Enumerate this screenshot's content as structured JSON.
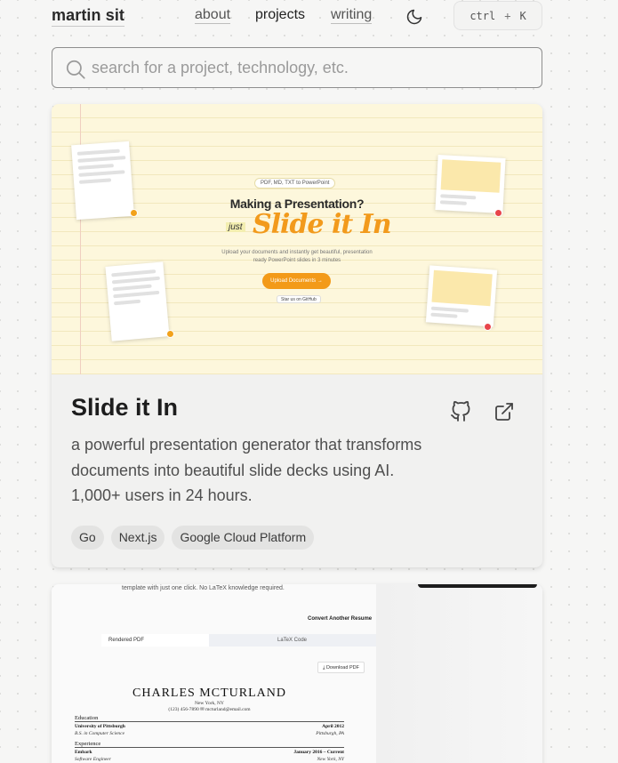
{
  "header": {
    "brand": "martin sit",
    "nav": [
      {
        "label": "about"
      },
      {
        "label": "projects"
      },
      {
        "label": "writing"
      }
    ],
    "shortcut": {
      "key1": "ctrl",
      "plus": "+",
      "key2": "K"
    },
    "theme_icon": "moon-icon"
  },
  "search": {
    "placeholder": "search for a project, technology, etc.",
    "value": "",
    "icon": "search-icon"
  },
  "projects": [
    {
      "title": "Slide it In",
      "description": "a powerful presentation generator that transforms documents into beautiful slide decks using AI. 1,000+ users in 24 hours.",
      "tags": [
        "Go",
        "Next.js",
        "Google Cloud Platform"
      ],
      "icons": [
        "github-icon",
        "external-link-icon"
      ],
      "screenshot": {
        "badge": "PDF, MD, TXT to PowerPoint",
        "headline": "Making a Presentation?",
        "just": "just",
        "brand": "Slide it In",
        "sub1": "Upload your documents and instantly get beautiful, presentation",
        "sub2": "ready PowerPoint slides in 3 minutes",
        "button": "Upload Documents →",
        "star": "Star us on GitHub"
      }
    },
    {
      "screenshot": {
        "top_text": "template with just one click. No LaTeX knowledge required.",
        "convert": "Convert Another Resume",
        "tab_a": "Rendered PDF",
        "tab_b": "LaTeX Code",
        "download": "⤓ Download PDF",
        "name": "CHARLES MCTURLAND",
        "location": "New York, NY",
        "contact": "(123) 456-7890  ✉ mcturland@email.com",
        "sections": {
          "education": "Education",
          "experience": "Experience"
        },
        "rows": {
          "school": "University of Pittsburgh",
          "school_date": "April 2012",
          "degree": "B.S. in Computer Science",
          "degree_loc": "Pittsburgh, PA",
          "company": "Embark",
          "company_date": "January 2016 – Current",
          "role": "Software Engineer",
          "role_loc": "New York, NY"
        }
      }
    }
  ]
}
